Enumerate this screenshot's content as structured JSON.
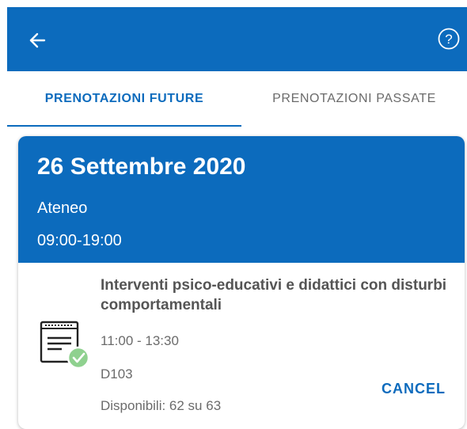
{
  "appbar": {
    "back_icon": "arrow-left-icon",
    "help_icon": "question-circle-icon",
    "help_symbol": "?"
  },
  "tabs": [
    {
      "label": "PRENOTAZIONI FUTURE",
      "selected": true
    },
    {
      "label": "PRENOTAZIONI PASSATE",
      "selected": false
    }
  ],
  "booking": {
    "date": "26 Settembre 2020",
    "place": "Ateneo",
    "hours": "09:00-19:00",
    "event": {
      "icon": "event-document-check-icon",
      "title": "Interventi psico-educativi e didattici con disturbi comportamentali",
      "time": "11:00 - 13:30",
      "room": "D103",
      "availability": "Disponibili: 62 su 63"
    },
    "cancel_label": "CANCEL"
  },
  "colors": {
    "primary": "#0c6bbd",
    "check": "#8fd18f"
  }
}
